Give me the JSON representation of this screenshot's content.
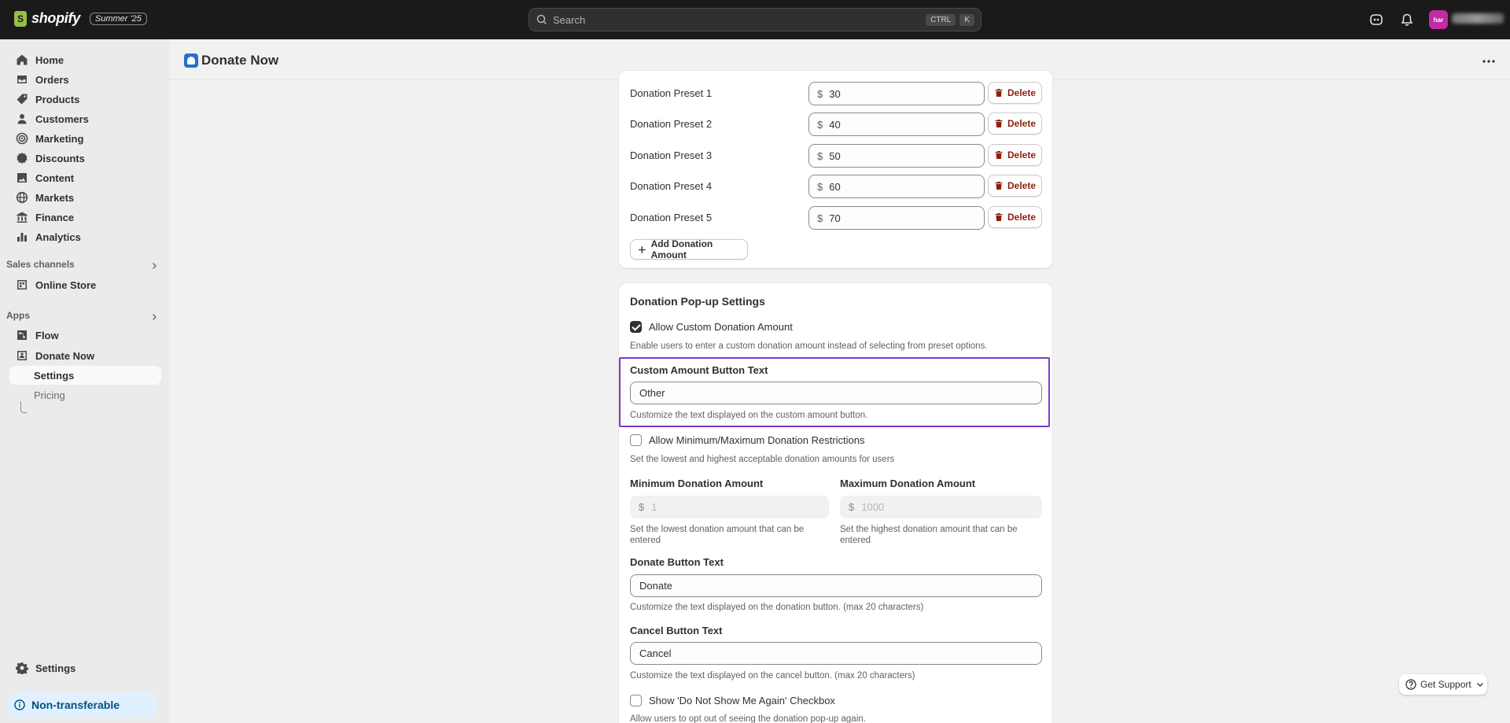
{
  "topbar": {
    "brand": "shopify",
    "edition_badge": "Summer '25",
    "search_placeholder": "Search",
    "shortcut_key1": "CTRL",
    "shortcut_key2": "K",
    "avatar_initials": "har"
  },
  "sidebar": {
    "items": [
      {
        "label": "Home",
        "icon": "home-icon"
      },
      {
        "label": "Orders",
        "icon": "orders-icon"
      },
      {
        "label": "Products",
        "icon": "tag-icon"
      },
      {
        "label": "Customers",
        "icon": "person-icon"
      },
      {
        "label": "Marketing",
        "icon": "target-icon"
      },
      {
        "label": "Discounts",
        "icon": "discount-icon"
      },
      {
        "label": "Content",
        "icon": "image-icon"
      },
      {
        "label": "Markets",
        "icon": "globe-icon"
      },
      {
        "label": "Finance",
        "icon": "bank-icon"
      },
      {
        "label": "Analytics",
        "icon": "bar-chart-icon"
      }
    ],
    "sales_channels_label": "Sales channels",
    "online_store": "Online Store",
    "apps_label": "Apps",
    "flow": "Flow",
    "donate_now": "Donate Now",
    "sub_settings": "Settings",
    "sub_pricing": "Pricing",
    "settings": "Settings",
    "non_transferable": "Non-transferable"
  },
  "page": {
    "title": "Donate Now"
  },
  "presets": [
    {
      "label": "Donation Preset 1",
      "currency": "$",
      "value": "30"
    },
    {
      "label": "Donation Preset 2",
      "currency": "$",
      "value": "40"
    },
    {
      "label": "Donation Preset 3",
      "currency": "$",
      "value": "50"
    },
    {
      "label": "Donation Preset 4",
      "currency": "$",
      "value": "60"
    },
    {
      "label": "Donation Preset 5",
      "currency": "$",
      "value": "70"
    }
  ],
  "delete_label": "Delete",
  "add_amount_label": "Add Donation Amount",
  "popup": {
    "title": "Donation Pop-up Settings",
    "allow_custom_label": "Allow Custom Donation Amount",
    "allow_custom_help": "Enable users to enter a custom donation amount instead of selecting from preset options.",
    "custom_button_label": "Custom Amount Button Text",
    "custom_button_value": "Other",
    "custom_button_help": "Customize the text displayed on the custom amount button.",
    "minmax_label": "Allow Minimum/Maximum Donation Restrictions",
    "minmax_help": "Set the lowest and highest acceptable donation amounts for users",
    "min_label": "Minimum Donation Amount",
    "min_currency": "$",
    "min_placeholder": "1",
    "min_help": "Set the lowest donation amount that can be entered",
    "max_label": "Maximum Donation Amount",
    "max_currency": "$",
    "max_placeholder": "1000",
    "max_help": "Set the highest donation amount that can be entered",
    "donate_btn_label": "Donate Button Text",
    "donate_btn_value": "Donate",
    "donate_btn_help": "Customize the text displayed on the donation button. (max 20 characters)",
    "cancel_btn_label": "Cancel Button Text",
    "cancel_btn_value": "Cancel",
    "cancel_btn_help": "Customize the text displayed on the cancel button. (max 20 characters)",
    "dont_show_label": "Show 'Do Not Show Me Again' Checkbox",
    "dont_show_help": "Allow users to opt out of seeing the donation pop-up again."
  },
  "support_label": "Get Support",
  "colors": {
    "topbar": "#1a1a1a",
    "highlight": "#7a3bd1",
    "delete": "#8e1f0b",
    "non_transferable_bg": "#e0f0ff",
    "avatar": "#c12ba4"
  }
}
